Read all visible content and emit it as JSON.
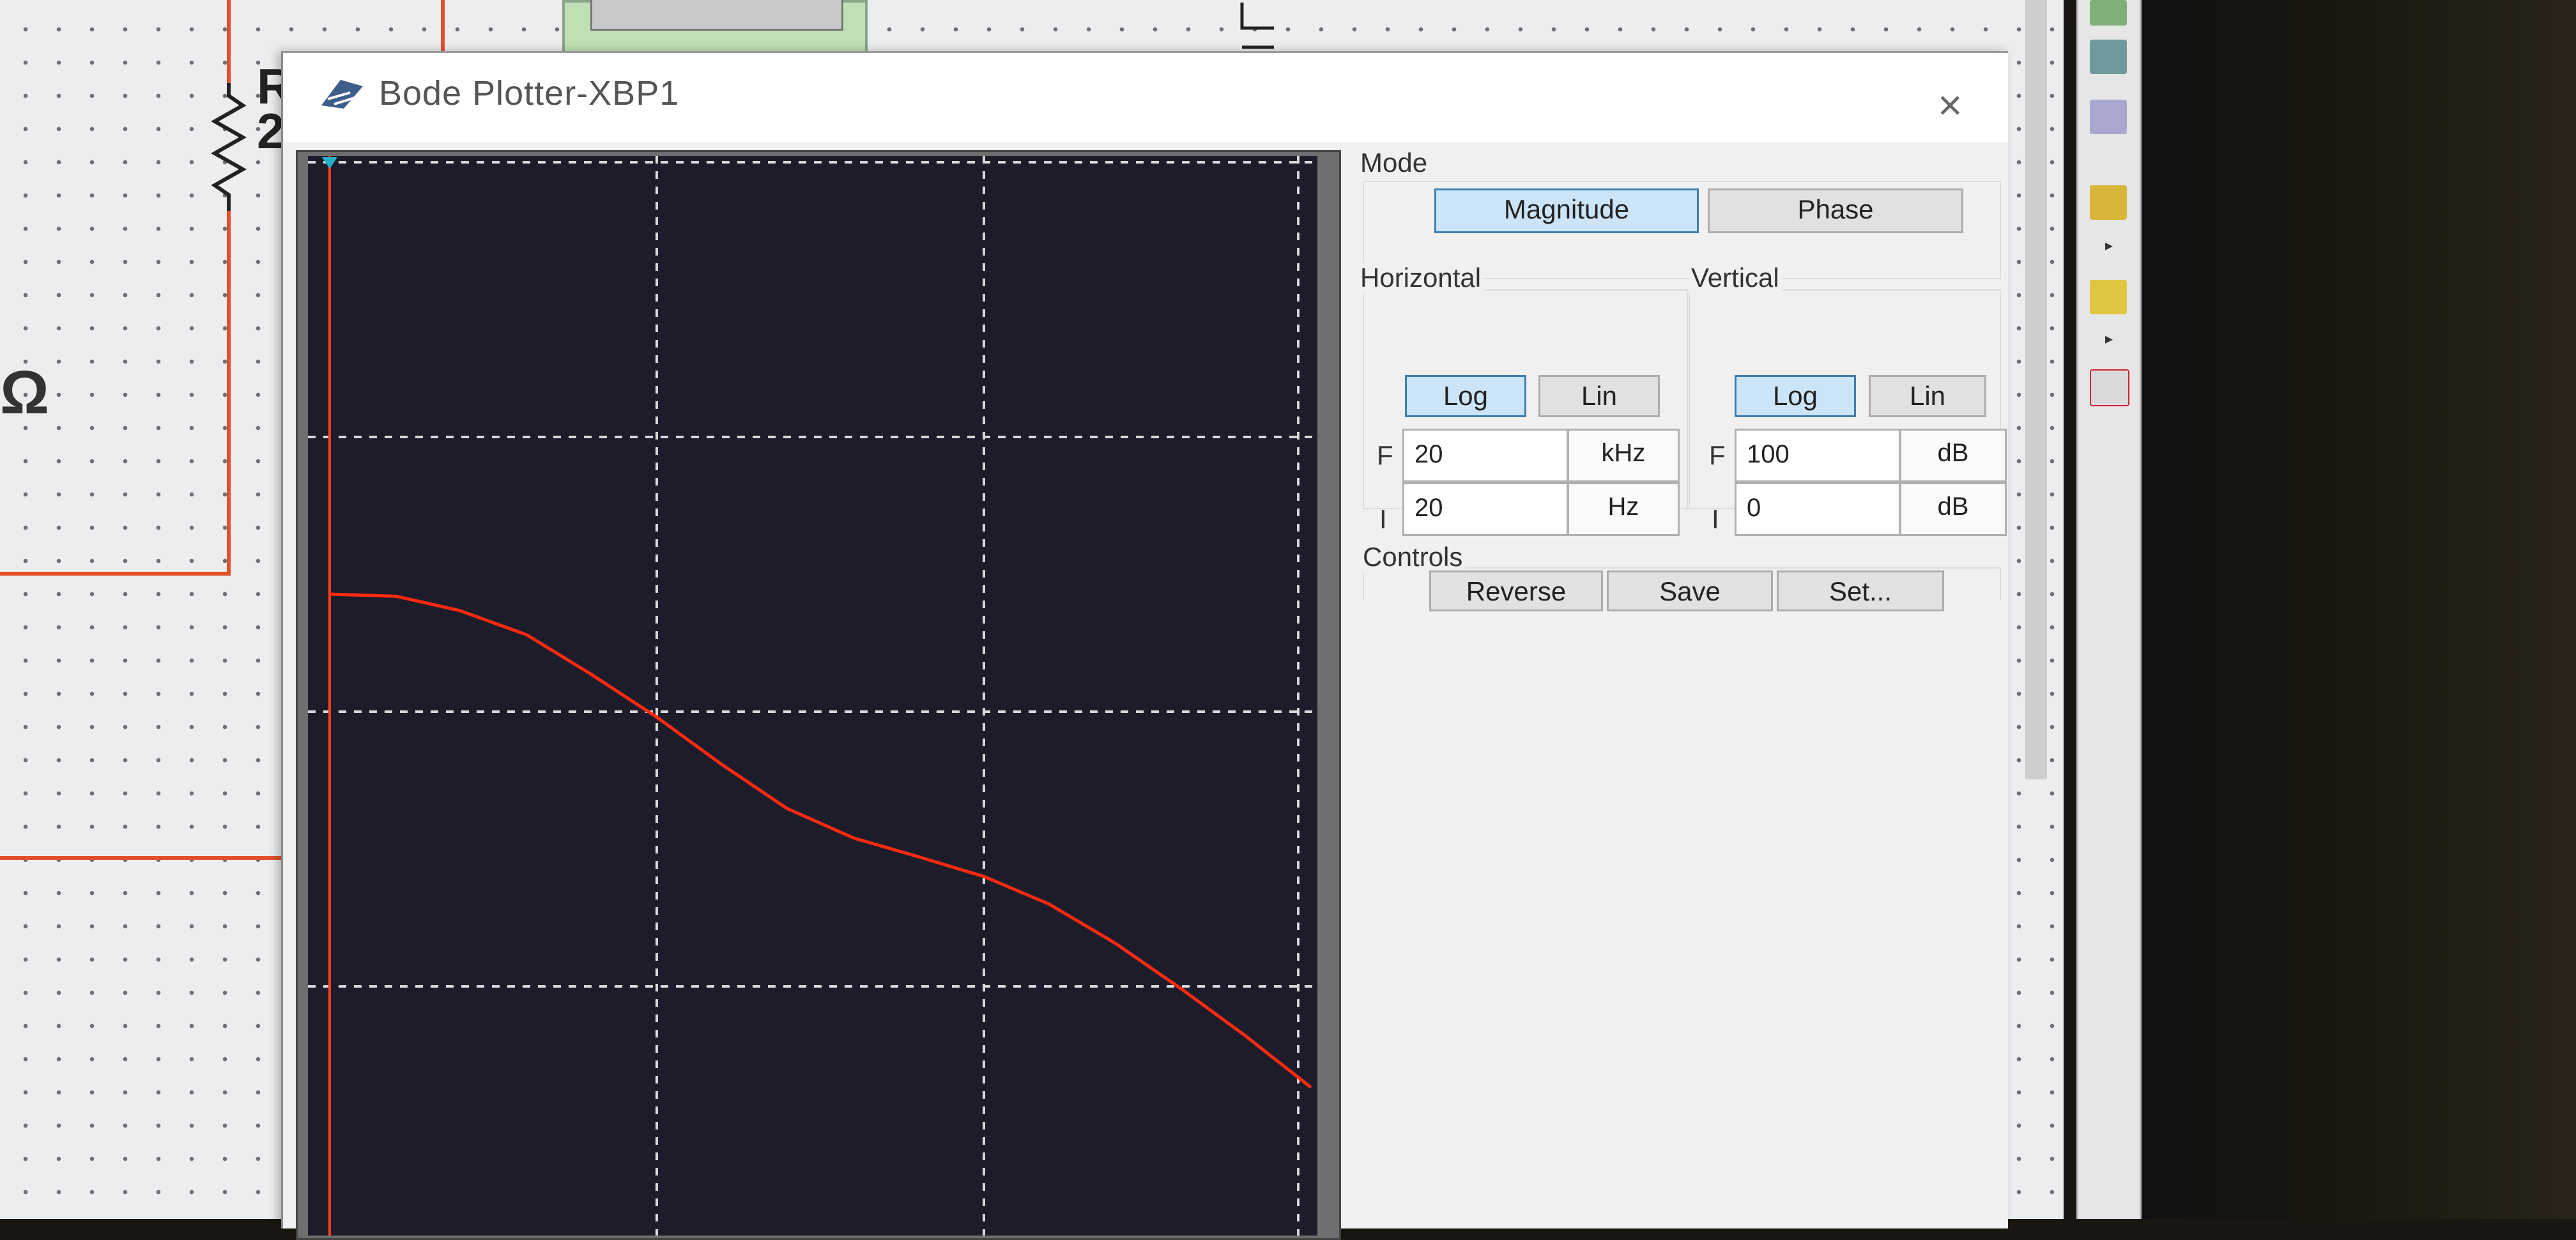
{
  "window": {
    "title": "Bode Plotter-XBP1",
    "close_glyph": "×"
  },
  "schematic": {
    "resistor_label": "R\n2",
    "ohm_symbol": "Ω"
  },
  "mode": {
    "label": "Mode",
    "magnitude_label": "Magnitude",
    "phase_label": "Phase",
    "selected": "Magnitude"
  },
  "horizontal": {
    "label": "Horizontal",
    "log_label": "Log",
    "lin_label": "Lin",
    "selected": "Log",
    "final_label": "F",
    "final_value": "20",
    "final_unit": "kHz",
    "initial_label": "I",
    "initial_value": "20",
    "initial_unit": "Hz"
  },
  "vertical": {
    "label": "Vertical",
    "log_label": "Log",
    "lin_label": "Lin",
    "selected": "Log",
    "final_label": "F",
    "final_value": "100",
    "final_unit": "dB",
    "initial_label": "I",
    "initial_value": "0",
    "initial_unit": "dB"
  },
  "controls": {
    "label": "Controls",
    "reverse_label": "Reverse",
    "save_label": "Save",
    "set_label": "Set..."
  },
  "colors": {
    "plot_background": "#1d1c2b",
    "trace": "#ff2a10",
    "grid": "#d8d8d8",
    "cursor": "#ff3b1f",
    "active_button": "#cce4f7",
    "wire": "#e2502a"
  },
  "icons": {
    "title": "bode-plotter-icon",
    "close": "close-icon",
    "cursor_marker": "cursor-marker-icon"
  },
  "chart_data": {
    "type": "line",
    "title": "",
    "xlabel": "",
    "ylabel": "",
    "x_scale": "log",
    "xlim": [
      20,
      20000
    ],
    "ylim": [
      0,
      100
    ],
    "grid": true,
    "series": [
      {
        "x": [
          20,
          32,
          50,
          80,
          126,
          200,
          316,
          500,
          800,
          1260,
          2000,
          3160,
          5000,
          8000,
          12600,
          20000
        ],
        "values": [
          60.7,
          60.5,
          59.2,
          57.0,
          53.4,
          49.5,
          45.2,
          41.2,
          38.5,
          36.8,
          35.0,
          32.5,
          29.0,
          24.8,
          20.5,
          15.8
        ]
      }
    ]
  }
}
